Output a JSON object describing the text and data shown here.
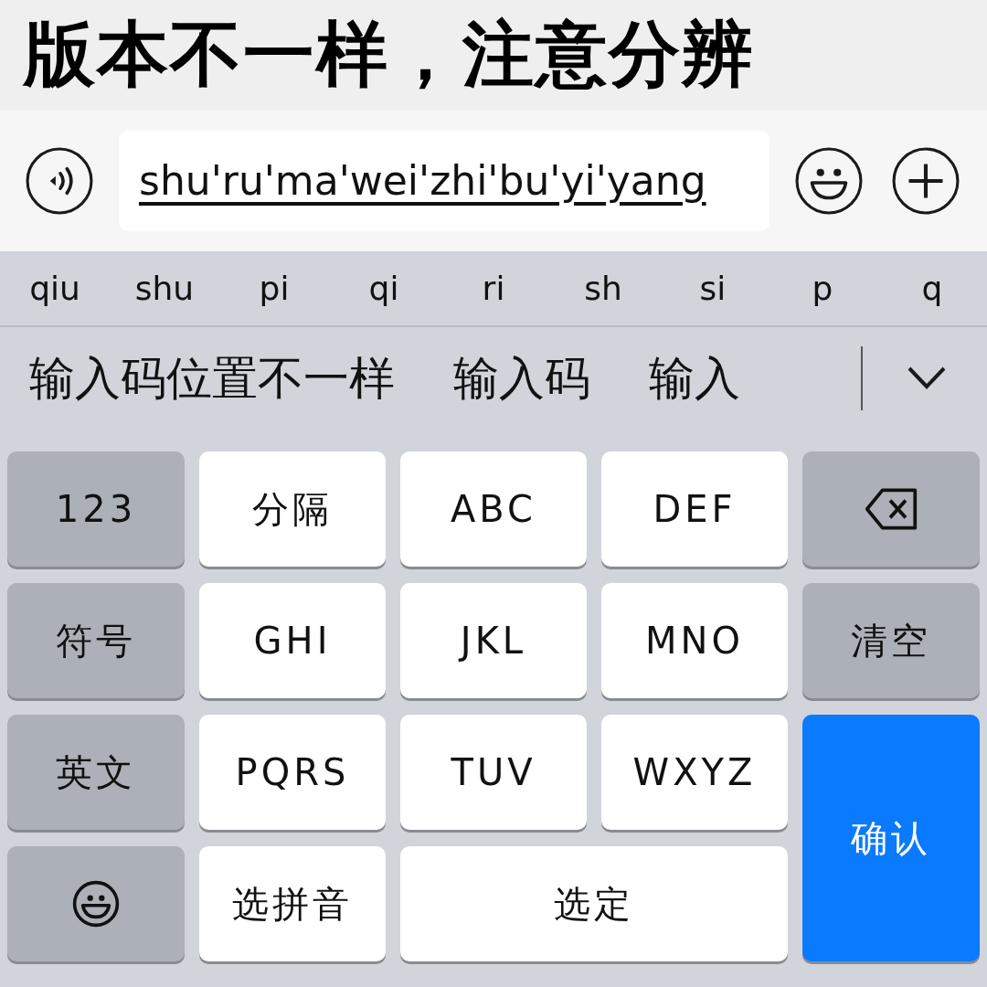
{
  "headline": "版本不一样，注意分辨",
  "input_bar": {
    "value": "shu'ru'ma'wei'zhi'bu'yi'yang"
  },
  "pinyin_options": [
    "qiu",
    "shu",
    "pi",
    "qi",
    "ri",
    "sh",
    "si",
    "p",
    "q"
  ],
  "candidates": [
    "输入码位置不一样",
    "输入码",
    "输入"
  ],
  "keys": [
    {
      "kind": "function",
      "label": "123"
    },
    {
      "kind": "letter",
      "label": "分隔"
    },
    {
      "kind": "letter",
      "label": "ABC"
    },
    {
      "kind": "letter",
      "label": "DEF"
    },
    {
      "kind": "backspace"
    },
    {
      "kind": "function",
      "label": "符号"
    },
    {
      "kind": "letter",
      "label": "GHI"
    },
    {
      "kind": "letter",
      "label": "JKL"
    },
    {
      "kind": "letter",
      "label": "MNO"
    },
    {
      "kind": "function",
      "label": "清空"
    },
    {
      "kind": "function",
      "label": "英文"
    },
    {
      "kind": "letter",
      "label": "PQRS"
    },
    {
      "kind": "letter",
      "label": "TUV"
    },
    {
      "kind": "letter",
      "label": "WXYZ"
    },
    {
      "kind": "confirm",
      "label": "确认"
    },
    {
      "kind": "emoji"
    },
    {
      "kind": "letter",
      "label": "选拼音"
    },
    {
      "kind": "space",
      "label": "选定"
    }
  ]
}
